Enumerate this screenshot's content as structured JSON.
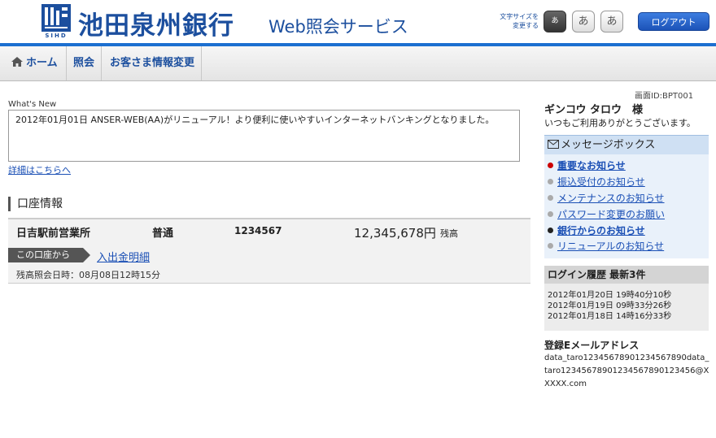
{
  "header": {
    "logo_sub": "SIHD",
    "bank_name": "池田泉州銀行",
    "service_name": "Web照会サービス",
    "font_size_label_1": "文字サイズを",
    "font_size_label_2": "変更する",
    "font_buttons": [
      "あ",
      "あ",
      "あ"
    ],
    "logout": "ログアウト"
  },
  "nav": {
    "home": "ホーム",
    "inquiry": "照会",
    "customer_info": "お客さま情報変更"
  },
  "screen_id": "画面ID:BPT001",
  "whats_new": {
    "label": "What's New",
    "text": "2012年01月01日 ANSER-WEB(AA)がリニューアル！より便利に使いやすいインターネットバンキングとなりました。",
    "detail_link": "詳細はこちらへ"
  },
  "account": {
    "section_title": "口座情報",
    "branch": "日吉駅前営業所",
    "type": "普通",
    "number": "1234567",
    "balance": "12,345,678円",
    "balance_label": "残高",
    "from_account": "この口座から",
    "history_link": "入出金明細",
    "inquiry_time": "残高照会日時：08月08日12時15分"
  },
  "user": {
    "name": "ギンコウ タロウ　様",
    "greeting": "いつもご利用ありがとうございます。"
  },
  "message_box": {
    "title": "メッセージボックス",
    "items": [
      {
        "label": "重要なお知らせ",
        "dot": "#cc0000",
        "bold": true
      },
      {
        "label": "振込受付のお知らせ",
        "dot": "#aaaaaa",
        "bold": false
      },
      {
        "label": "メンテナンスのお知らせ",
        "dot": "#aaaaaa",
        "bold": false
      },
      {
        "label": "パスワード変更のお願い",
        "dot": "#aaaaaa",
        "bold": false
      },
      {
        "label": "銀行からのお知らせ",
        "dot": "#222222",
        "bold": true
      },
      {
        "label": "リニューアルのお知らせ",
        "dot": "#aaaaaa",
        "bold": false
      }
    ]
  },
  "login_history": {
    "title": "ログイン履歴 最新3件",
    "entries": [
      "2012年01月20日 19時40分10秒",
      "2012年01月19日 09時33分26秒",
      "2012年01月18日 14時16分33秒"
    ]
  },
  "email": {
    "title": "登録Eメールアドレス",
    "value": "data_taro12345678901234567890data_taro12345678901234567890123456@XXXXX.com"
  }
}
